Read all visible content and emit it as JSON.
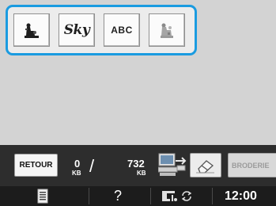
{
  "categories": [
    {
      "name": "one-point-pattern",
      "icon": "character-pattern-icon"
    },
    {
      "name": "font-sky",
      "label": "Sky",
      "icon": "sky-font-icon"
    },
    {
      "name": "font-abc",
      "label": "ABC",
      "icon": "abc-font-icon"
    },
    {
      "name": "pattern-frame",
      "icon": "greyed-pattern-icon"
    }
  ],
  "toolbar": {
    "back_label": "RETOUR",
    "memory_used": "0",
    "memory_used_unit": "KB",
    "memory_slash": "/",
    "memory_total": "732",
    "memory_total_unit": "KB",
    "usb_icon": "usb-computer-icon",
    "eraser_icon": "eraser-icon",
    "embroidery_label": "BRODERIE"
  },
  "statusbar": {
    "page_icon": "document-icon",
    "help_label": "?",
    "settings_icon": "machine-settings-icon",
    "cycle_icon": "rotate-arrows-icon",
    "time": "12:00"
  },
  "colors": {
    "highlight": "#1a9be0",
    "background": "#d3d3d3",
    "toolbar": "#2d2d2d",
    "statusbar": "#1c1c1c"
  }
}
